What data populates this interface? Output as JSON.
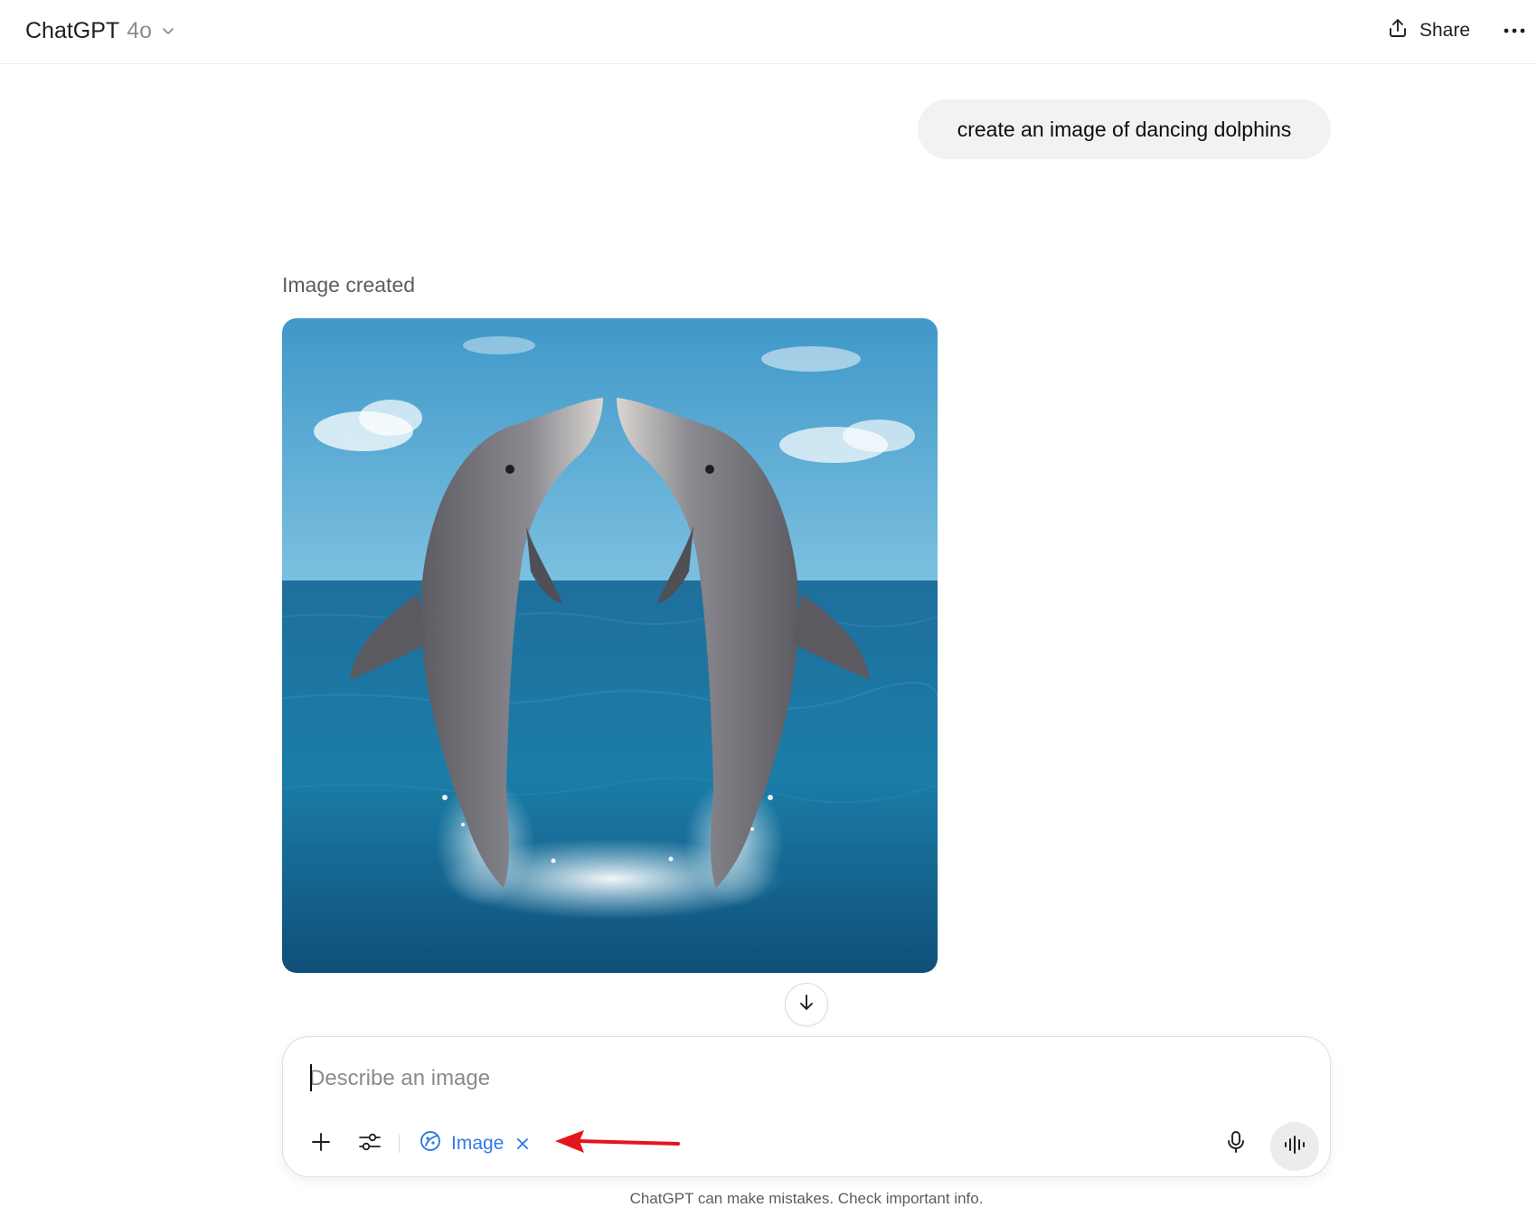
{
  "header": {
    "app_name": "ChatGPT",
    "model": "4o",
    "share_label": "Share"
  },
  "conversation": {
    "user_message": "create an image of dancing dolphins",
    "assistant_status": "Image created"
  },
  "composer": {
    "placeholder": "Describe an image",
    "value": "",
    "active_tool": "Image"
  },
  "footer": {
    "disclaimer": "ChatGPT can make mistakes. Check important info."
  },
  "colors": {
    "accent_blue": "#2f7ae5",
    "annotation_red": "#e4161b",
    "bubble_bg": "#f2f2f2"
  },
  "icons": [
    "chevron-down-icon",
    "share-icon",
    "more-icon",
    "arrow-down-icon",
    "plus-icon",
    "sliders-icon",
    "image-tool-icon",
    "close-icon",
    "mic-icon",
    "voice-wave-icon"
  ]
}
